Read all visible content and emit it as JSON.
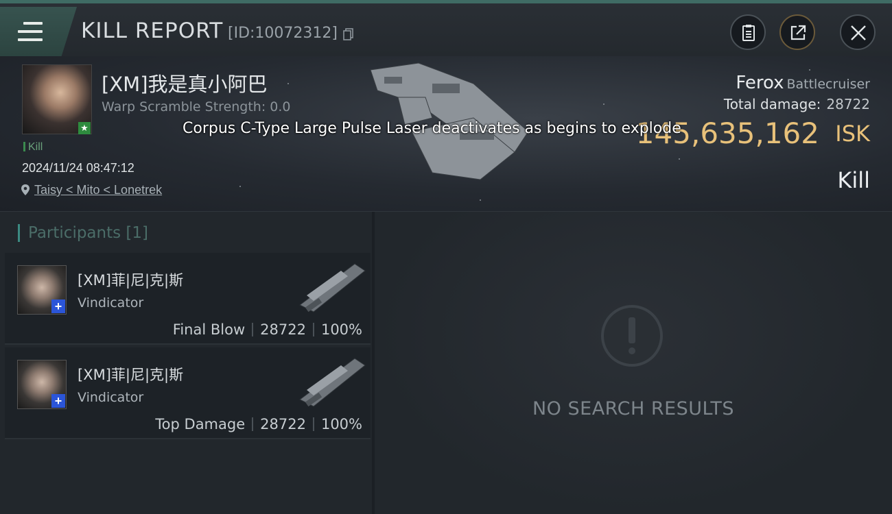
{
  "header": {
    "title": "KILL REPORT",
    "report_id": "[ID:10072312]"
  },
  "victim": {
    "name": "[XM]我是真小阿巴",
    "warp_scramble": "Warp Scramble Strength: 0.0",
    "tag": "Kill",
    "timestamp": "2024/11/24 08:47:12",
    "location": "Taisy < Mito < Lonetrek"
  },
  "ship": {
    "name": "Ferox",
    "class": "Battlecruiser",
    "total_damage_label": "Total damage:",
    "total_damage": "28722",
    "isk_value": "145,635,162",
    "isk_unit": "ISK",
    "kill_type": "Kill"
  },
  "overlay_message": "Corpus C-Type Large Pulse Laser deactivates as  begins to explode",
  "participants": {
    "title": "Participants [1]",
    "rows": [
      {
        "name": "[XM]菲|尼|克|斯",
        "ship": "Vindicator",
        "role": "Final Blow",
        "damage": "28722",
        "percent": "100%"
      },
      {
        "name": "[XM]菲|尼|克|斯",
        "ship": "Vindicator",
        "role": "Top Damage",
        "damage": "28722",
        "percent": "100%"
      }
    ]
  },
  "results": {
    "empty_text": "NO SEARCH RESULTS"
  },
  "colors": {
    "accent": "#3f6b64",
    "isk_gold": "#e8c17a",
    "badge_green": "#2e8b3e",
    "plus_blue": "#2b55d8"
  },
  "icons": {
    "menu": "hamburger-menu-icon",
    "copy": "copy-icon",
    "clipboard": "clipboard-icon",
    "export": "share-export-icon",
    "close": "close-icon",
    "location": "location-pin-icon",
    "empty": "exclamation-icon"
  }
}
